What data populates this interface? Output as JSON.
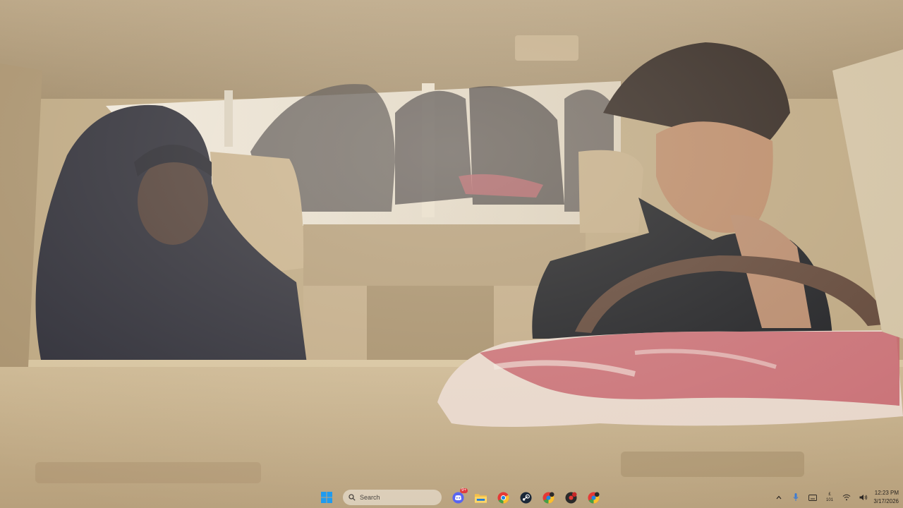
{
  "taskbar": {
    "search_placeholder": "Search",
    "pinned_apps": [
      {
        "icon": "discord-icon",
        "badge": "9+"
      },
      {
        "icon": "file-explorer-icon"
      },
      {
        "icon": "chrome-icon"
      },
      {
        "icon": "steam-icon"
      },
      {
        "icon": "chrome-profile-icon"
      },
      {
        "icon": "chrome-profile-icon"
      },
      {
        "icon": "chrome-profile-icon"
      }
    ],
    "language": {
      "line1": "£",
      "line2": "101"
    },
    "clock": {
      "time": "12:23 PM",
      "date": "3/17/2026"
    }
  },
  "colors": {
    "car_interior": "#c9b594",
    "taskbar_text": "#2b2622",
    "windows_blue": "#1f9bf0",
    "discord": "#5865f2",
    "badge": "#e0393e"
  }
}
